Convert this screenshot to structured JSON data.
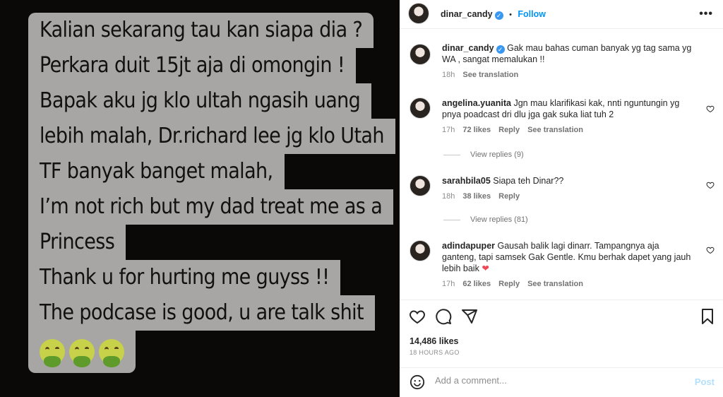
{
  "media": {
    "lines": [
      "Kalian sekarang tau kan siapa dia ?",
      "Perkara duit 15jt aja di omongin !",
      "Bapak aku jg klo ultah ngasih uang",
      "lebih malah, Dr.richard lee jg klo Utah",
      "TF banyak banget malah,",
      "I’m not rich but my dad treat me as a",
      "Princess",
      "Thank u for hurting me guyss !!",
      "The podcase is good, u are talk shit"
    ],
    "emojis": [
      "nauseated-face",
      "nauseated-face",
      "nauseated-face"
    ]
  },
  "header": {
    "username": "dinar_candy",
    "separator": "•",
    "follow_label": "Follow",
    "more_label": "•••"
  },
  "caption": {
    "username": "dinar_candy",
    "text": "Gak mau bahas cuman banyak yg tag sama yg WA , sangat memalukan !!",
    "time": "18h",
    "translate": "See translation"
  },
  "comments": [
    {
      "username": "angelina.yuanita",
      "text": "Jgn mau klarifikasi kak, nnti nguntungin yg pnya poadcast dri dlu jga gak suka liat tuh 2",
      "time": "17h",
      "likes": "72 likes",
      "reply": "Reply",
      "translate": "See translation",
      "view_replies": "View replies (9)"
    },
    {
      "username": "sarahbila05",
      "text": "Siapa teh Dinar??",
      "time": "18h",
      "likes": "38 likes",
      "reply": "Reply",
      "view_replies": "View replies (81)"
    },
    {
      "username": "adindapuper",
      "text": "Gausah balik lagi dinarr. Tampangnya aja ganteng, tapi samsek Gak Gentle. Kmu berhak dapet yang jauh lebih baik",
      "time": "17h",
      "likes": "62 likes",
      "reply": "Reply",
      "translate": "See translation"
    }
  ],
  "post": {
    "likes": "14,486 likes",
    "time": "18 HOURS AGO"
  },
  "add_comment": {
    "placeholder": "Add a comment...",
    "post_label": "Post"
  },
  "colors": {
    "link_blue": "#0095f6",
    "media_bg": "#0b0808",
    "bubble": "#a8a5a5",
    "heart_red": "#ed4956"
  }
}
